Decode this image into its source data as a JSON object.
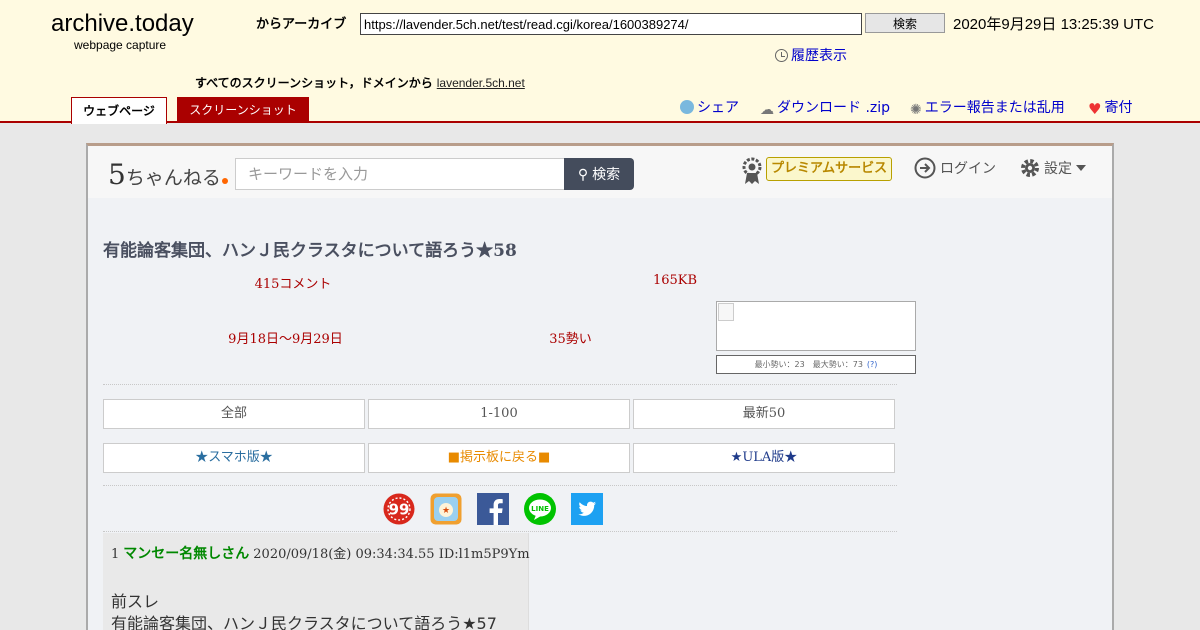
{
  "archive": {
    "title": "archive.today",
    "subtitle": "webpage capture",
    "archive_label": "からアーカイブ",
    "url": "https://lavender.5ch.net/test/read.cgi/korea/1600389274/",
    "search_label": "検索",
    "date": "2020年9月29日 13:25:39 UTC",
    "history_label": "履歴表示",
    "all_shots_label": "すべてのスクリーンショット，ドメインから",
    "domain": "lavender.5ch.net",
    "tab_webpage": "ウェブページ",
    "tab_screenshot": "スクリーンショット",
    "share_label": "シェア",
    "download_label": "ダウンロード .zip",
    "report_label": "エラー報告または乱用",
    "donate_label": "寄付"
  },
  "site": {
    "logo": "ちゃんねる",
    "logo_digit": "5",
    "search_placeholder": "キーワードを入力",
    "search_label": "検索",
    "premium_label": "プレミアムサービス",
    "login_label": "ログイン",
    "settings_label": "設定"
  },
  "thread": {
    "title": "有能論客集団、ハンＪ民クラスタについて語ろう★58",
    "comments": "415コメント",
    "size": "165KB",
    "dates": "9月18日〜9月29日",
    "momentum": "35勢い",
    "trend_info": "最小勢い：23　最大勢い：73",
    "trend_help": "(?)"
  },
  "buttons": {
    "all": "全部",
    "range": "1-100",
    "latest": "最新50",
    "smartphone": "★スマホ版★",
    "back": "■掲示板に戻る■",
    "ula": "★ULA版★"
  },
  "social": [
    "99-icon",
    "matome-icon",
    "facebook-icon",
    "line-icon",
    "twitter-icon"
  ],
  "post": {
    "number": "1",
    "name": "マンセー名無しさん",
    "date": "2020/09/18(金) 09:34:34.55",
    "id": "ID:l1m5P9Ym",
    "body_line1": "前スレ",
    "body_line2": "有能論客集団、ハンＪ民クラスタについて語ろう★57"
  },
  "colors": {
    "archive_bg": "#fffae1",
    "archive_accent": "#aa0000",
    "page_bg": "#f0f2f5",
    "meta_red": "#aa0000",
    "poster_green": "#008800"
  }
}
